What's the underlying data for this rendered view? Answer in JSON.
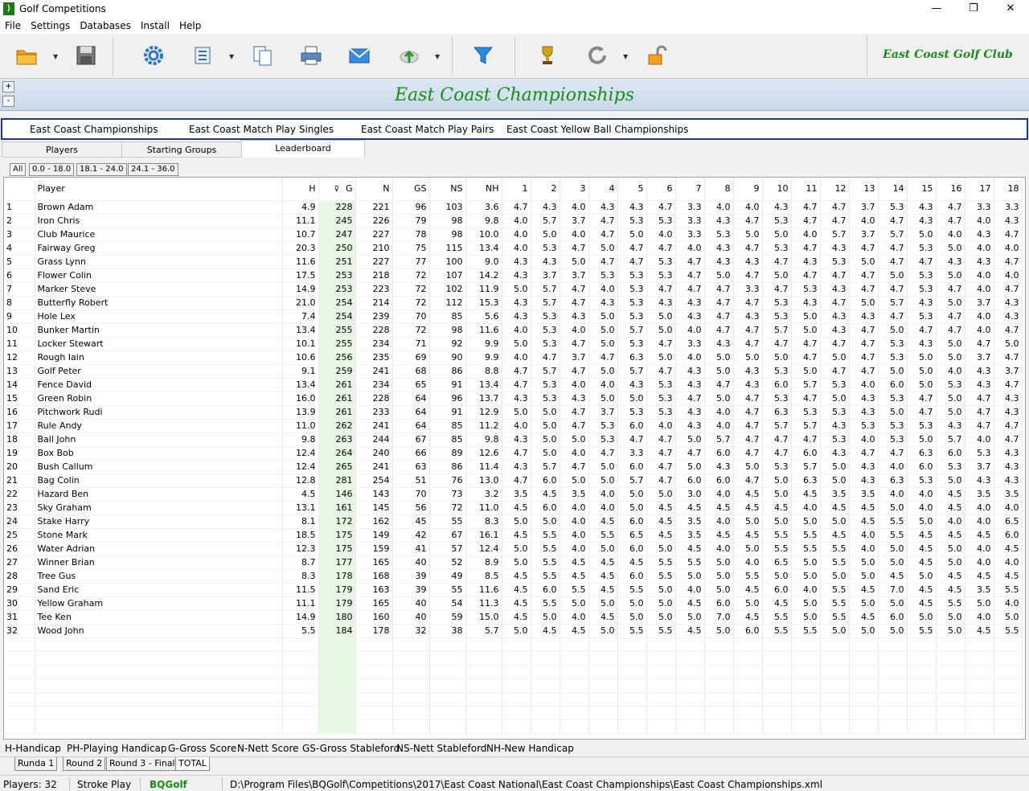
{
  "window": {
    "title": "Golf Competitions",
    "minimize": "—",
    "restore": "❐",
    "close": "✕"
  },
  "menu": [
    "File",
    "Settings",
    "Databases",
    "Install",
    "Help"
  ],
  "club_name": "East Coast Golf Club",
  "banner": {
    "title": "East Coast Championships",
    "plus": "+",
    "minus": "-"
  },
  "competition_tabs": [
    "East Coast Championships",
    "East Coast Match Play Singles",
    "East Coast Match Play Pairs",
    "East Coast Yellow Ball Championships"
  ],
  "view_tabs": [
    "Players",
    "Starting Groups",
    "Leaderboard"
  ],
  "handicap_tabs": [
    "All",
    "0.0 - 18.0",
    "18.1 - 24.0",
    "24.1 - 36.0"
  ],
  "grid": {
    "columns": [
      "",
      "Player",
      "H",
      "G",
      "N",
      "GS",
      "NS",
      "NH",
      "1",
      "2",
      "3",
      "4",
      "5",
      "6",
      "7",
      "8",
      "9",
      "10",
      "11",
      "12",
      "13",
      "14",
      "15",
      "16",
      "17",
      "18"
    ],
    "sort_indicator": "⊽",
    "rows": [
      [
        "1",
        "Brown Adam",
        "4.9",
        "228",
        "221",
        "96",
        "103",
        "3.6",
        "4.7",
        "4.3",
        "4.0",
        "4.3",
        "4.3",
        "4.7",
        "3.3",
        "4.0",
        "4.0",
        "4.3",
        "4.7",
        "4.7",
        "3.7",
        "5.3",
        "4.3",
        "4.7",
        "3.3",
        "3.3"
      ],
      [
        "2",
        "Iron Chris",
        "11.1",
        "245",
        "226",
        "79",
        "98",
        "9.8",
        "4.0",
        "5.7",
        "3.7",
        "4.7",
        "5.3",
        "5.3",
        "3.3",
        "4.3",
        "4.7",
        "5.3",
        "4.7",
        "4.7",
        "4.0",
        "4.7",
        "4.3",
        "4.7",
        "4.0",
        "4.3"
      ],
      [
        "3",
        "Club Maurice",
        "10.7",
        "247",
        "227",
        "78",
        "98",
        "10.0",
        "4.0",
        "5.0",
        "4.0",
        "4.7",
        "5.0",
        "4.0",
        "3.3",
        "5.3",
        "5.0",
        "5.0",
        "4.0",
        "5.7",
        "3.7",
        "5.7",
        "5.0",
        "4.0",
        "4.3",
        "4.7"
      ],
      [
        "4",
        "Fairway Greg",
        "20.3",
        "250",
        "210",
        "75",
        "115",
        "13.4",
        "4.0",
        "5.3",
        "4.7",
        "5.0",
        "4.7",
        "4.7",
        "4.0",
        "4.3",
        "4.7",
        "5.3",
        "4.7",
        "4.3",
        "4.7",
        "4.7",
        "5.3",
        "5.0",
        "4.0",
        "4.0"
      ],
      [
        "5",
        "Grass Lynn",
        "11.6",
        "251",
        "227",
        "77",
        "100",
        "9.0",
        "4.3",
        "4.3",
        "5.0",
        "4.7",
        "4.7",
        "5.3",
        "4.7",
        "4.3",
        "4.3",
        "4.7",
        "4.3",
        "5.3",
        "5.0",
        "4.7",
        "4.7",
        "4.3",
        "4.3",
        "4.7"
      ],
      [
        "6",
        "Flower Colin",
        "17.5",
        "253",
        "218",
        "72",
        "107",
        "14.2",
        "4.3",
        "3.7",
        "3.7",
        "5.3",
        "5.3",
        "5.3",
        "4.7",
        "5.0",
        "4.7",
        "5.0",
        "4.7",
        "4.7",
        "4.7",
        "5.0",
        "5.3",
        "5.0",
        "4.0",
        "4.0"
      ],
      [
        "7",
        "Marker Steve",
        "14.9",
        "253",
        "223",
        "72",
        "102",
        "11.9",
        "5.0",
        "5.7",
        "4.7",
        "4.0",
        "5.3",
        "4.7",
        "4.7",
        "4.7",
        "3.3",
        "4.7",
        "5.3",
        "4.3",
        "4.7",
        "4.7",
        "5.3",
        "4.7",
        "4.0",
        "4.7"
      ],
      [
        "8",
        "Butterfly Robert",
        "21.0",
        "254",
        "214",
        "72",
        "112",
        "15.3",
        "4.3",
        "5.7",
        "4.7",
        "4.3",
        "5.3",
        "4.3",
        "4.3",
        "4.7",
        "4.7",
        "5.3",
        "4.3",
        "4.7",
        "5.0",
        "5.7",
        "4.3",
        "5.0",
        "3.7",
        "4.3"
      ],
      [
        "9",
        "Hole Lex",
        "7.4",
        "254",
        "239",
        "70",
        "85",
        "5.6",
        "4.3",
        "5.3",
        "4.3",
        "5.0",
        "5.3",
        "5.0",
        "4.3",
        "4.7",
        "4.3",
        "5.3",
        "5.0",
        "4.3",
        "4.3",
        "4.7",
        "5.3",
        "4.7",
        "4.0",
        "4.3"
      ],
      [
        "10",
        "Bunker Martin",
        "13.4",
        "255",
        "228",
        "72",
        "98",
        "11.6",
        "4.0",
        "5.3",
        "4.0",
        "5.0",
        "5.7",
        "5.0",
        "4.0",
        "4.7",
        "4.7",
        "5.7",
        "5.0",
        "4.3",
        "4.7",
        "5.0",
        "4.7",
        "4.7",
        "4.0",
        "4.7"
      ],
      [
        "11",
        "Locker Stewart",
        "10.1",
        "255",
        "234",
        "71",
        "92",
        "9.9",
        "5.0",
        "5.3",
        "4.7",
        "5.0",
        "5.3",
        "4.7",
        "3.3",
        "4.3",
        "4.7",
        "4.7",
        "4.7",
        "4.7",
        "4.7",
        "5.3",
        "4.3",
        "5.0",
        "4.7",
        "5.0"
      ],
      [
        "12",
        "Rough Iain",
        "10.6",
        "256",
        "235",
        "69",
        "90",
        "9.9",
        "4.0",
        "4.7",
        "3.7",
        "4.7",
        "6.3",
        "5.0",
        "4.0",
        "5.0",
        "5.0",
        "5.0",
        "4.7",
        "5.0",
        "4.7",
        "5.3",
        "5.0",
        "5.0",
        "3.7",
        "4.7"
      ],
      [
        "13",
        "Golf Peter",
        "9.1",
        "259",
        "241",
        "68",
        "86",
        "8.8",
        "4.7",
        "5.7",
        "4.7",
        "5.0",
        "5.7",
        "4.7",
        "4.3",
        "5.0",
        "4.3",
        "5.3",
        "5.0",
        "4.7",
        "4.7",
        "5.0",
        "5.0",
        "4.0",
        "4.3",
        "3.7"
      ],
      [
        "14",
        "Fence David",
        "13.4",
        "261",
        "234",
        "65",
        "91",
        "13.4",
        "4.7",
        "5.3",
        "4.0",
        "4.0",
        "4.3",
        "5.3",
        "4.3",
        "4.7",
        "4.3",
        "6.0",
        "5.7",
        "5.3",
        "4.0",
        "6.0",
        "5.0",
        "5.3",
        "4.3",
        "4.7"
      ],
      [
        "15",
        "Green Robin",
        "16.0",
        "261",
        "228",
        "64",
        "96",
        "13.7",
        "4.3",
        "5.3",
        "4.3",
        "5.0",
        "5.0",
        "5.3",
        "4.7",
        "5.0",
        "4.7",
        "5.3",
        "4.7",
        "5.0",
        "4.3",
        "5.3",
        "4.7",
        "5.0",
        "4.7",
        "4.3"
      ],
      [
        "16",
        "Pitchwork Rudi",
        "13.9",
        "261",
        "233",
        "64",
        "91",
        "12.9",
        "5.0",
        "5.0",
        "4.7",
        "3.7",
        "5.3",
        "5.3",
        "4.3",
        "4.0",
        "4.7",
        "6.3",
        "5.3",
        "5.3",
        "4.3",
        "5.0",
        "4.7",
        "5.0",
        "4.7",
        "4.3"
      ],
      [
        "17",
        "Rule Andy",
        "11.0",
        "262",
        "241",
        "64",
        "85",
        "11.2",
        "4.0",
        "5.0",
        "4.7",
        "5.3",
        "6.0",
        "4.0",
        "4.3",
        "4.0",
        "4.7",
        "5.7",
        "5.7",
        "4.3",
        "5.3",
        "5.3",
        "5.3",
        "4.3",
        "4.7",
        "4.7"
      ],
      [
        "18",
        "Ball John",
        "9.8",
        "263",
        "244",
        "67",
        "85",
        "9.8",
        "4.3",
        "5.0",
        "5.0",
        "5.3",
        "4.7",
        "4.7",
        "5.0",
        "5.7",
        "4.7",
        "4.7",
        "4.7",
        "5.3",
        "4.0",
        "5.3",
        "5.0",
        "5.7",
        "4.0",
        "4.7"
      ],
      [
        "19",
        "Box Bob",
        "12.4",
        "264",
        "240",
        "66",
        "89",
        "12.6",
        "4.7",
        "5.0",
        "4.0",
        "4.7",
        "3.3",
        "4.7",
        "4.7",
        "6.0",
        "4.7",
        "4.7",
        "6.0",
        "4.3",
        "4.7",
        "4.7",
        "6.3",
        "6.0",
        "5.3",
        "4.3"
      ],
      [
        "20",
        "Bush Callum",
        "12.4",
        "265",
        "241",
        "63",
        "86",
        "11.4",
        "4.3",
        "5.7",
        "4.7",
        "5.0",
        "6.0",
        "4.7",
        "5.0",
        "4.3",
        "5.0",
        "5.3",
        "5.7",
        "5.0",
        "4.3",
        "4.0",
        "6.0",
        "5.3",
        "3.7",
        "4.3"
      ],
      [
        "21",
        "Bag Colin",
        "12.8",
        "281",
        "254",
        "51",
        "76",
        "13.0",
        "4.7",
        "6.0",
        "5.0",
        "5.0",
        "5.7",
        "4.7",
        "6.0",
        "6.0",
        "4.7",
        "5.0",
        "6.3",
        "5.0",
        "4.3",
        "6.3",
        "5.3",
        "5.0",
        "4.3",
        "4.3"
      ],
      [
        "22",
        "Hazard Ben",
        "4.5",
        "146",
        "143",
        "70",
        "73",
        "3.2",
        "3.5",
        "4.5",
        "3.5",
        "4.0",
        "5.0",
        "5.0",
        "3.0",
        "4.0",
        "4.5",
        "5.0",
        "4.5",
        "3.5",
        "3.5",
        "4.0",
        "4.0",
        "4.5",
        "3.5",
        "3.5"
      ],
      [
        "23",
        "Sky Graham",
        "13.1",
        "161",
        "145",
        "56",
        "72",
        "11.0",
        "4.5",
        "6.0",
        "4.0",
        "4.0",
        "5.0",
        "4.5",
        "4.5",
        "4.5",
        "4.5",
        "4.5",
        "4.0",
        "4.5",
        "4.5",
        "5.0",
        "4.0",
        "4.5",
        "4.0",
        "4.0"
      ],
      [
        "24",
        "Stake Harry",
        "8.1",
        "172",
        "162",
        "45",
        "55",
        "8.3",
        "5.0",
        "5.0",
        "4.0",
        "4.5",
        "6.0",
        "4.5",
        "3.5",
        "4.0",
        "5.0",
        "5.0",
        "5.0",
        "5.0",
        "4.5",
        "5.5",
        "5.0",
        "4.0",
        "4.0",
        "6.5"
      ],
      [
        "25",
        "Stone Mark",
        "18.5",
        "175",
        "149",
        "42",
        "67",
        "16.1",
        "4.5",
        "5.5",
        "4.0",
        "5.5",
        "6.5",
        "4.5",
        "3.5",
        "4.5",
        "4.5",
        "5.5",
        "5.5",
        "4.5",
        "4.0",
        "5.5",
        "4.5",
        "4.5",
        "4.5",
        "6.0"
      ],
      [
        "26",
        "Water Adrian",
        "12.3",
        "175",
        "159",
        "41",
        "57",
        "12.4",
        "5.0",
        "5.5",
        "4.0",
        "5.0",
        "6.0",
        "5.0",
        "4.5",
        "4.0",
        "5.0",
        "5.5",
        "5.5",
        "5.5",
        "4.0",
        "5.0",
        "4.5",
        "5.0",
        "4.0",
        "4.5"
      ],
      [
        "27",
        "Winner Brian",
        "8.7",
        "177",
        "165",
        "40",
        "52",
        "8.9",
        "5.0",
        "5.5",
        "4.5",
        "4.5",
        "4.5",
        "5.5",
        "5.5",
        "5.0",
        "4.0",
        "6.5",
        "5.0",
        "5.5",
        "5.0",
        "5.0",
        "4.5",
        "5.0",
        "4.0",
        "4.0"
      ],
      [
        "28",
        "Tree Gus",
        "8.3",
        "178",
        "168",
        "39",
        "49",
        "8.5",
        "4.5",
        "5.5",
        "4.5",
        "4.5",
        "6.0",
        "5.5",
        "5.0",
        "5.0",
        "5.5",
        "5.0",
        "5.0",
        "5.0",
        "5.0",
        "4.5",
        "5.0",
        "4.5",
        "4.5",
        "4.5"
      ],
      [
        "29",
        "Sand Eric",
        "11.5",
        "179",
        "163",
        "39",
        "55",
        "11.6",
        "4.5",
        "6.0",
        "5.5",
        "4.5",
        "5.5",
        "5.0",
        "4.0",
        "5.0",
        "4.5",
        "6.0",
        "4.0",
        "5.5",
        "4.5",
        "7.0",
        "4.5",
        "4.5",
        "3.5",
        "5.5"
      ],
      [
        "30",
        "Yellow Graham",
        "11.1",
        "179",
        "165",
        "40",
        "54",
        "11.3",
        "4.5",
        "5.5",
        "5.0",
        "5.0",
        "5.0",
        "5.0",
        "4.5",
        "6.0",
        "5.0",
        "4.5",
        "5.0",
        "5.5",
        "5.0",
        "5.0",
        "4.5",
        "5.5",
        "5.0",
        "4.0"
      ],
      [
        "31",
        "Tee Ken",
        "14.9",
        "180",
        "160",
        "40",
        "59",
        "15.0",
        "4.5",
        "5.0",
        "4.0",
        "4.5",
        "5.0",
        "5.0",
        "5.0",
        "7.0",
        "4.5",
        "5.5",
        "5.0",
        "5.5",
        "4.5",
        "6.0",
        "5.0",
        "5.0",
        "4.0",
        "5.0"
      ],
      [
        "32",
        "Wood John",
        "5.5",
        "184",
        "178",
        "32",
        "38",
        "5.7",
        "5.0",
        "4.5",
        "4.5",
        "5.0",
        "5.5",
        "5.5",
        "4.5",
        "5.0",
        "6.0",
        "5.5",
        "5.5",
        "5.0",
        "5.0",
        "5.0",
        "5.5",
        "5.0",
        "4.5",
        "5.5"
      ]
    ]
  },
  "legend": [
    "H-Handicap",
    "PH-Playing Handicap",
    "G-Gross Score",
    "N-Nett Score",
    "GS-Gross Stableford",
    "NS-Nett Stableford",
    "NH-New Handicap"
  ],
  "round_tabs": [
    "Runda 1",
    "Round 2",
    "Round 3 - Final",
    "TOTAL"
  ],
  "status": {
    "players": "Players: 32",
    "mode": "Stroke Play",
    "brand": "BQGolf",
    "path": "D:\\Program Files\\BQGolf\\Competitions\\2017\\East Coast National\\East Coast Championships\\East Coast Championships.xml"
  },
  "colors": {
    "accent_green": "#1a8c1a",
    "banner_blue": "#dce8f4",
    "gross_highlight": "#e6f8e4",
    "tab_border": "#203a7a"
  }
}
